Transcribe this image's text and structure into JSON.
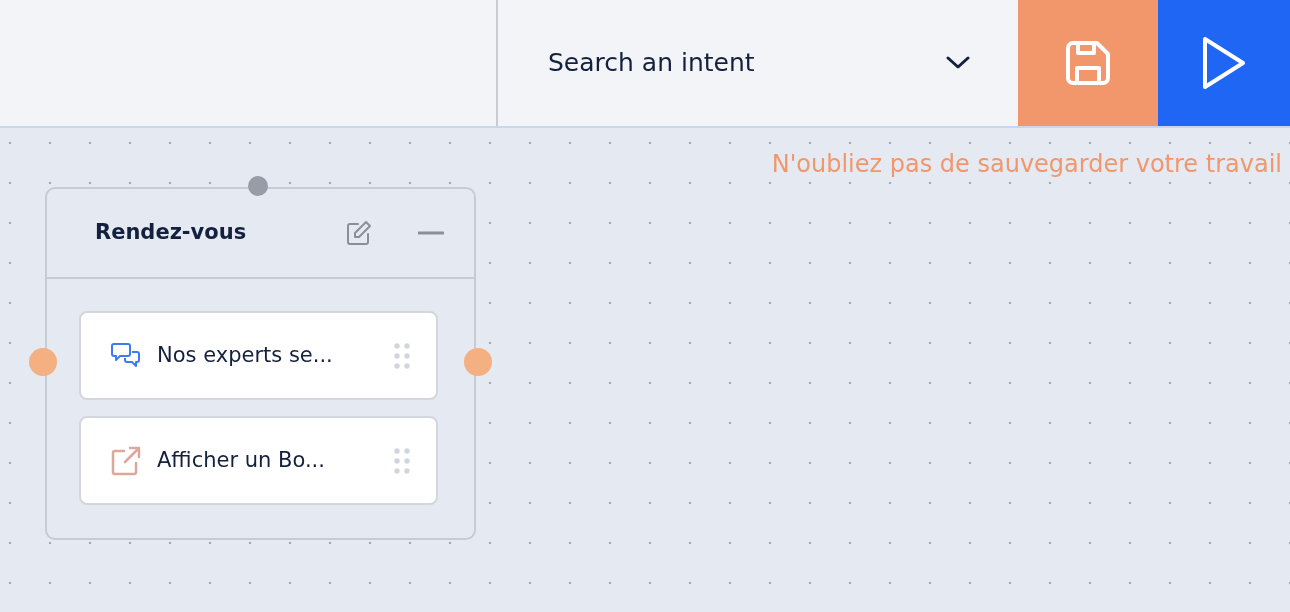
{
  "toolbar": {
    "search": {
      "placeholder": "Search an intent"
    },
    "buttons": [
      {
        "kind": "save"
      },
      {
        "kind": "run"
      }
    ]
  },
  "notice": "N'oubliez pas de sauvegarder votre travail",
  "node": {
    "title": "Rendez-vous",
    "steps": [
      {
        "kind": "message",
        "label": "Nos experts se..."
      },
      {
        "kind": "link",
        "label": "Afficher un Bo..."
      }
    ]
  }
}
